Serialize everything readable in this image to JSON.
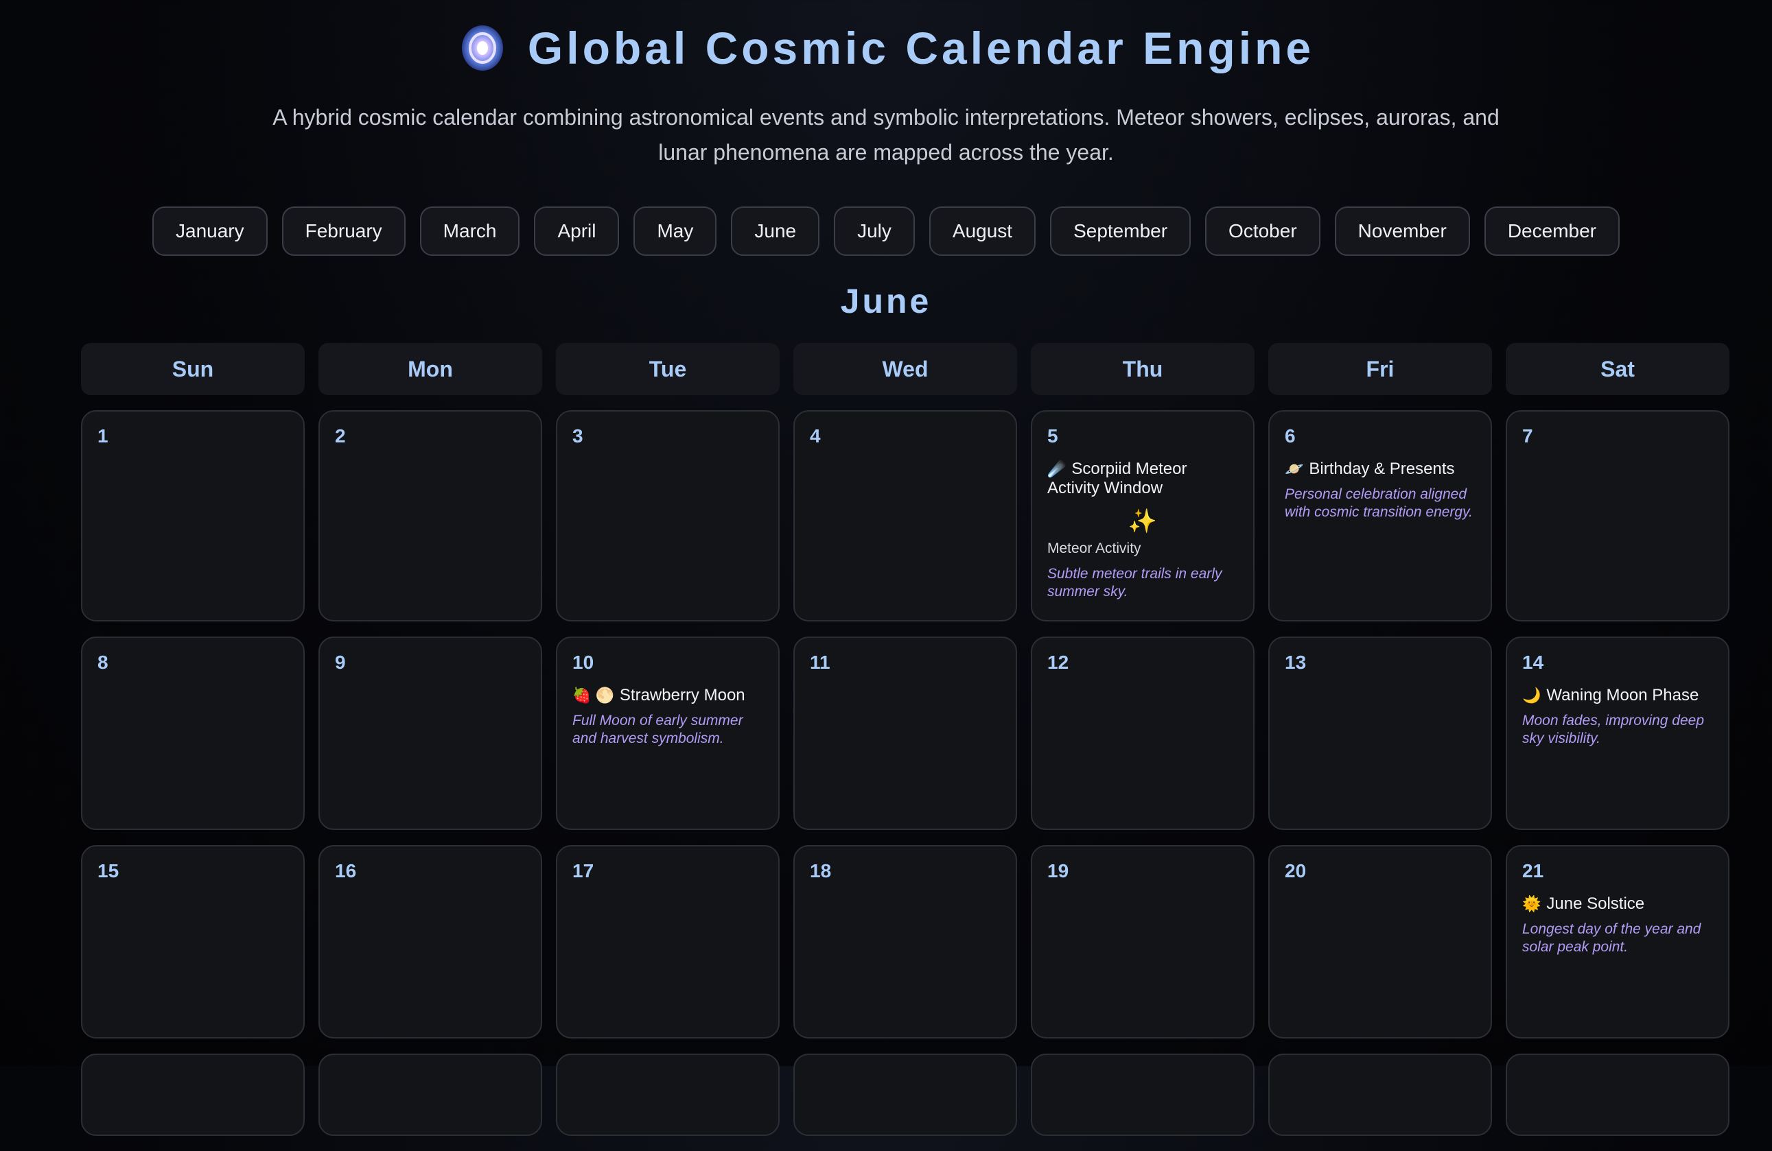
{
  "header": {
    "logo_icon": "galaxy-icon",
    "title": "Global Cosmic Calendar Engine",
    "subtitle": "A hybrid cosmic calendar combining astronomical events and symbolic interpretations. Meteor showers, eclipses, auroras, and lunar phenomena are mapped across the year."
  },
  "months": [
    "January",
    "February",
    "March",
    "April",
    "May",
    "June",
    "July",
    "August",
    "September",
    "October",
    "November",
    "December"
  ],
  "current_month": "June",
  "weekdays": [
    "Sun",
    "Mon",
    "Tue",
    "Wed",
    "Thu",
    "Fri",
    "Sat"
  ],
  "days": {
    "d1": "1",
    "d2": "2",
    "d3": "3",
    "d4": "4",
    "d5": "5",
    "d6": "6",
    "d7": "7",
    "d8": "8",
    "d9": "9",
    "d10": "10",
    "d11": "11",
    "d12": "12",
    "d13": "13",
    "d14": "14",
    "d15": "15",
    "d16": "16",
    "d17": "17",
    "d18": "18",
    "d19": "19",
    "d20": "20",
    "d21": "21"
  },
  "events": {
    "scorpiid": {
      "icon": "☄️",
      "title": "Scorpiid Meteor Activity Window",
      "sparkle": "✨",
      "label": "Meteor Activity",
      "desc": "Subtle meteor trails in early summer sky."
    },
    "birthday": {
      "icon": "🪐",
      "title": "Birthday & Presents",
      "desc": "Personal celebration aligned with cosmic transition energy."
    },
    "strawberry": {
      "icon": "🍓 🌕",
      "title": "Strawberry Moon",
      "desc": "Full Moon of early summer and harvest symbolism."
    },
    "waning": {
      "icon": "🌙",
      "title": "Waning Moon Phase",
      "desc": "Moon fades, improving deep sky visibility."
    },
    "solstice": {
      "icon": "🌞",
      "title": "June Solstice",
      "desc": "Longest day of the year and solar peak point."
    }
  }
}
